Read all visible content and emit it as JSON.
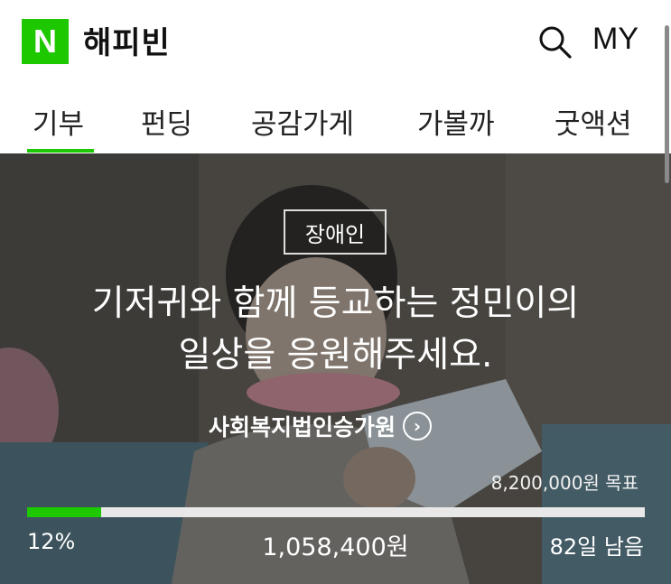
{
  "header": {
    "logo_letter": "N",
    "brand": "해피빈",
    "my_label": "MY",
    "search_icon": "search-icon"
  },
  "tabs": [
    {
      "label": "기부",
      "active": true
    },
    {
      "label": "펀딩",
      "active": false
    },
    {
      "label": "공감가게",
      "active": false
    },
    {
      "label": "가볼까",
      "active": false
    },
    {
      "label": "굿액션",
      "active": false
    }
  ],
  "campaign": {
    "category": "장애인",
    "title_line1": "기저귀와 함께 등교하는 정민이의",
    "title_line2": "일상을 응원해주세요.",
    "organization": "사회복지법인승가원",
    "goal_text": "8,200,000원 목표",
    "progress_fraction": 0.12,
    "percent_text": "12%",
    "raised_text": "1,058,400원",
    "days_left_text": "82일 남음"
  },
  "colors": {
    "brand_green": "#1ec800",
    "text_dark": "#111111",
    "bar_track": "#e8e8e8"
  }
}
